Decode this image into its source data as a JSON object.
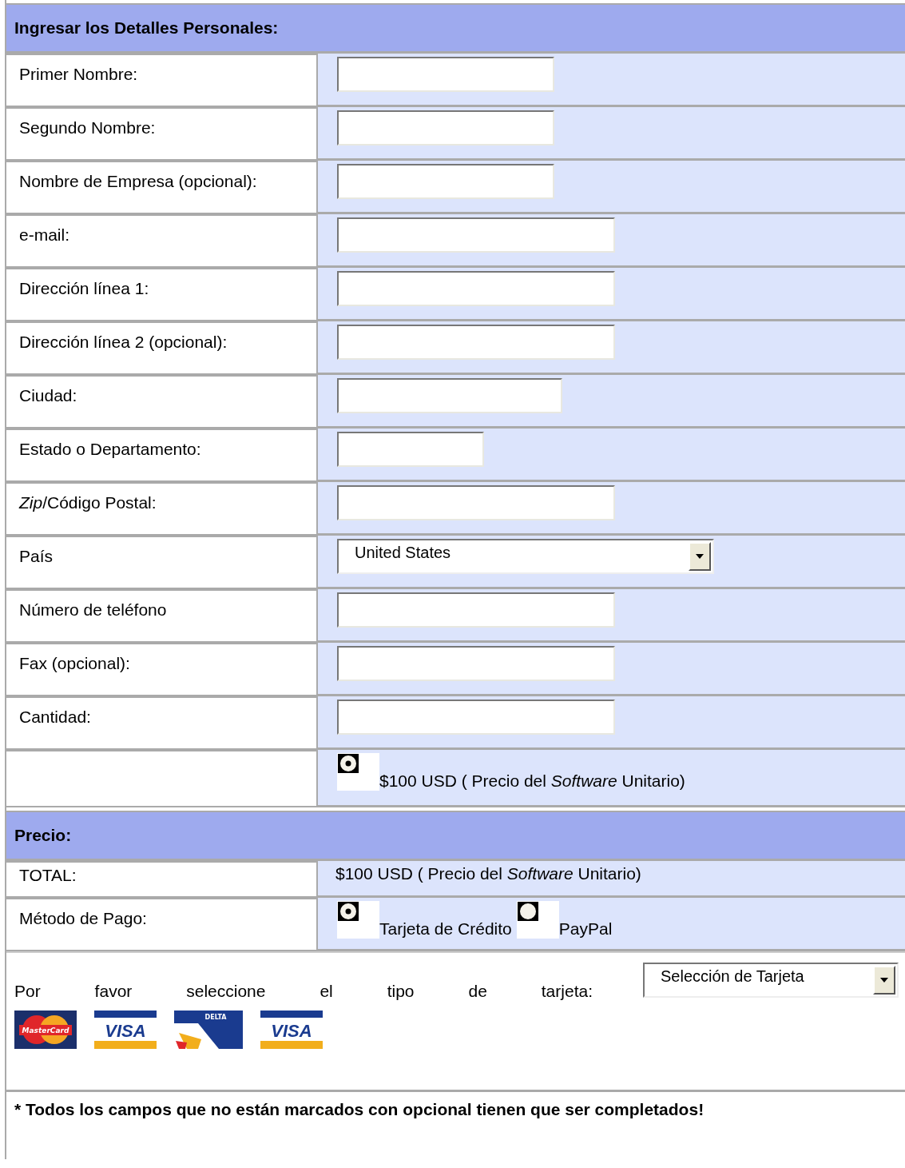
{
  "personal": {
    "title": "Ingresar los Detalles Personales:",
    "rows": [
      {
        "kind": "text",
        "label": "Primer Nombre:"
      },
      {
        "kind": "text",
        "label": "Segundo Nombre:"
      },
      {
        "kind": "text",
        "label": "Nombre de Empresa (opcional):"
      },
      {
        "kind": "text",
        "label": "e-mail:"
      },
      {
        "kind": "text",
        "label": "Dirección línea 1:"
      },
      {
        "kind": "text",
        "label": "Dirección línea 2 (opcional):"
      },
      {
        "kind": "text",
        "label": "Ciudad:"
      },
      {
        "kind": "text",
        "label": "Estado o Departamento:"
      },
      {
        "kind": "text",
        "label": "*Zip*/Código Postal:"
      },
      {
        "kind": "select",
        "label": "País",
        "value": "United States"
      },
      {
        "kind": "text",
        "label": "Número de teléfono"
      },
      {
        "kind": "text",
        "label": "Fax (opcional):"
      },
      {
        "kind": "text",
        "label": "Cantidad:"
      },
      {
        "kind": "radio",
        "options": [
          {
            "label": "$100 USD ( Precio del *Software* Unitario)",
            "selected": true
          }
        ]
      }
    ]
  },
  "price": {
    "title": "Precio:",
    "rows": [
      {
        "kind": "info",
        "label": "TOTAL:",
        "value": "$100 USD ( Precio del *Software* Unitario)"
      },
      {
        "kind": "radio",
        "label": "Método de Pago:",
        "options": [
          {
            "label": "Tarjeta de Crédito",
            "selected": true
          },
          {
            "label": "PayPal",
            "selected": false
          }
        ]
      }
    ]
  },
  "card_type": {
    "prompt": "Por favor seleccione el tipo de tarjeta:",
    "select": "Selección de Tarjeta",
    "cards": [
      {
        "kind": "mastercard",
        "text": "MasterCard"
      },
      {
        "kind": "visa",
        "text": "VISA"
      },
      {
        "kind": "delta",
        "text": "DELTA"
      },
      {
        "kind": "visa",
        "text": "VISA"
      }
    ]
  },
  "note": "* Todos los campos que no están marcados con opcional tienen que ser completados!"
}
